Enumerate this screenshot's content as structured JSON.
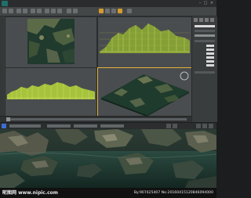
{
  "window": {
    "title": ""
  },
  "viewports": [
    {
      "label": "",
      "name": "top"
    },
    {
      "label": "",
      "name": "front"
    },
    {
      "label": "",
      "name": "left"
    },
    {
      "label": "",
      "name": "perspective"
    }
  ],
  "watermark": {
    "left_text": "昵图网 www.nipic.com",
    "right_text": "By:907425407 No:20160415120846094000"
  },
  "colors": {
    "ui_bg": "#3c3f40",
    "viewport_bg": "#4a4d4f",
    "wireframe_green": "#a7c23a",
    "terrain_dark": "#1f3a2c",
    "active_border": "#e1b43a"
  }
}
